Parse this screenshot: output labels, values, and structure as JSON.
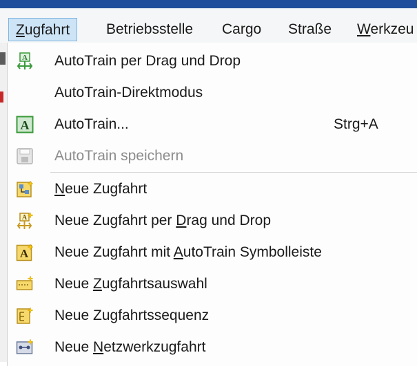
{
  "menubar": {
    "items": [
      {
        "label": "Zugfahrt",
        "accel": "Z",
        "rest": "ugfahrt"
      },
      {
        "label": "Betriebsstelle"
      },
      {
        "label": "Cargo"
      },
      {
        "label": "Straße"
      },
      {
        "label": "Werkzeu",
        "accel": "W",
        "rest": "erkzeu"
      }
    ]
  },
  "dropdown": {
    "items": [
      {
        "label": "AutoTrain per Drag und Drop",
        "icon": "autotrain-drag-icon"
      },
      {
        "label": "AutoTrain-Direktmodus"
      },
      {
        "label": "AutoTrain...",
        "shortcut": "Strg+A",
        "icon": "autotrain-icon"
      },
      {
        "label": "AutoTrain speichern",
        "disabled": true,
        "icon": "save-icon"
      },
      {
        "pre": "",
        "accel": "N",
        "post": "eue Zugfahrt",
        "icon": "new-train-path-icon"
      },
      {
        "pre": "Neue Zugfahrt per ",
        "accel": "D",
        "post": "rag und Drop",
        "icon": "new-train-drag-icon"
      },
      {
        "pre": "Neue Zugfahrt mit ",
        "accel": "A",
        "post": "utoTrain Symbolleiste",
        "icon": "new-train-autotrain-icon"
      },
      {
        "pre": "Neue ",
        "accel": "Z",
        "post": "ugfahrtsauswahl",
        "icon": "new-train-selection-icon"
      },
      {
        "pre": "Neue Zugfahrtssequenz",
        "accel": "",
        "post": "",
        "icon": "new-train-sequence-icon"
      },
      {
        "pre": "Neue ",
        "accel": "N",
        "post": "etzwerkzugfahrt",
        "icon": "new-network-train-icon"
      }
    ]
  },
  "colors": {
    "titlebar": "#1f4e9c",
    "menu_active_bg": "#cde4f7",
    "menu_active_border": "#7fb3e0",
    "icon_green": "#3a9a3a",
    "icon_yellow": "#f2c94c"
  }
}
